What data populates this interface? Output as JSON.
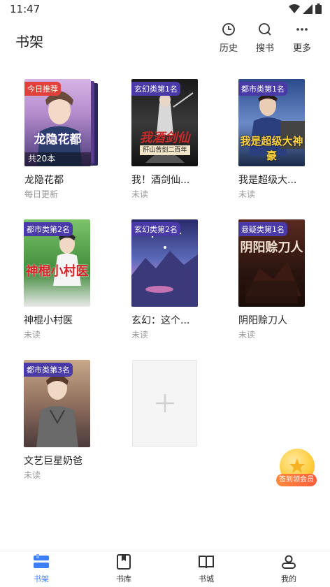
{
  "status_bar": {
    "time": "11:47"
  },
  "header": {
    "title": "书架",
    "actions": [
      {
        "label": "历史",
        "icon": "clock-icon"
      },
      {
        "label": "搜书",
        "icon": "search-icon"
      },
      {
        "label": "更多",
        "icon": "more-icon"
      }
    ]
  },
  "books": [
    {
      "badge": "今日推荐",
      "title": "龙隐花都",
      "status": "每日更新",
      "count": "共20本",
      "cover_text": "龙隐花都"
    },
    {
      "badge": "玄幻类第1名",
      "title": "我！酒剑仙...",
      "status": "未读",
      "cover_text": "我酒剑仙",
      "cover_sub": "肝山苦剑二百年"
    },
    {
      "badge": "都市类第1名",
      "title": "我是超级大...",
      "status": "未读",
      "cover_text": "我是超级大神豪"
    },
    {
      "badge": "都市类第2名",
      "title": "神棍小村医",
      "status": "未读",
      "cover_text": "神棍小村医"
    },
    {
      "badge": "玄幻类第2名",
      "title": "玄幻：这个...",
      "status": "未读"
    },
    {
      "badge": "悬疑类第1名",
      "title": "阴阳赊刀人",
      "status": "未读",
      "cover_text": "阴阳赊刀人"
    },
    {
      "badge": "都市类第3名",
      "title": "文艺巨星奶爸",
      "status": "未读"
    }
  ],
  "vip": {
    "label": "签到领会员"
  },
  "tabs": [
    {
      "label": "书架",
      "active": true
    },
    {
      "label": "书库"
    },
    {
      "label": "书城"
    },
    {
      "label": "我的"
    }
  ],
  "colors": {
    "accent": "#3b7ef6",
    "badge_purple": "#4a3aa8",
    "badge_red": "#e2403a"
  }
}
